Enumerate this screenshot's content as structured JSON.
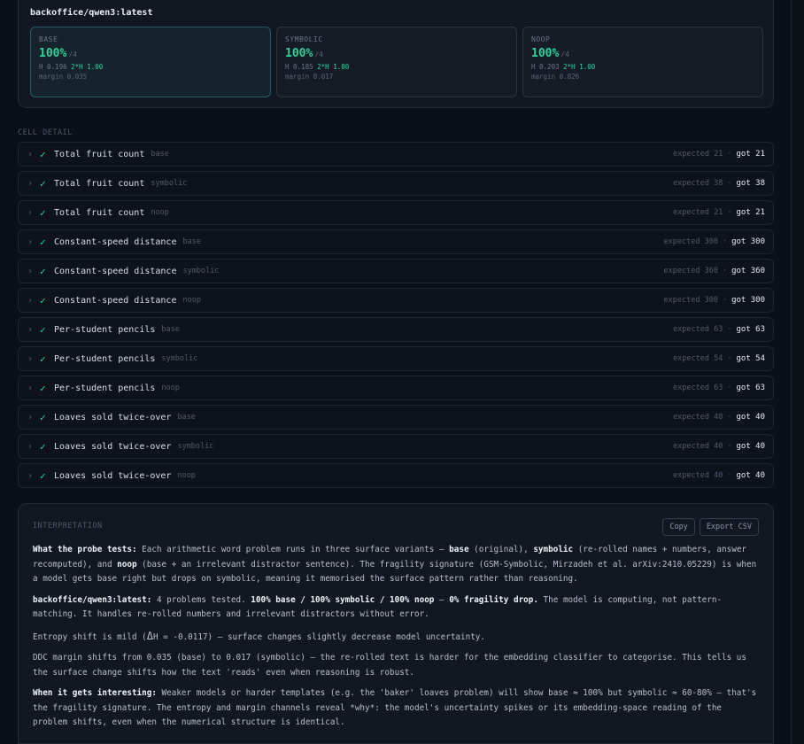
{
  "model": "backoffice/qwen3:latest",
  "variants": [
    {
      "name": "BASE",
      "score": "100%",
      "total": "/4",
      "h_label": "H",
      "h_value": "0.196",
      "h2_label": "2*H",
      "h2_value": "1.00",
      "margin_label": "margin",
      "margin_value": "0.035"
    },
    {
      "name": "SYMBOLIC",
      "score": "100%",
      "total": "/4",
      "h_label": "H",
      "h_value": "0.185",
      "h2_label": "2*H",
      "h2_value": "1.00",
      "margin_label": "margin",
      "margin_value": "0.017"
    },
    {
      "name": "NOOP",
      "score": "100%",
      "total": "/4",
      "h_label": "H",
      "h_value": "0.203",
      "h2_label": "2*H",
      "h2_value": "1.00",
      "margin_label": "margin",
      "margin_value": "0.026"
    }
  ],
  "cell_detail_label": "CELL DETAIL",
  "rows": [
    {
      "chev": "›",
      "check": "✓",
      "title": "Total fruit count",
      "variant": "base",
      "expected": "expected 21",
      "sep": "·",
      "got": "got 21"
    },
    {
      "chev": "›",
      "check": "✓",
      "title": "Total fruit count",
      "variant": "symbolic",
      "expected": "expected 38",
      "sep": "·",
      "got": "got 38"
    },
    {
      "chev": "›",
      "check": "✓",
      "title": "Total fruit count",
      "variant": "noop",
      "expected": "expected 21",
      "sep": "·",
      "got": "got 21"
    },
    {
      "chev": "›",
      "check": "✓",
      "title": "Constant-speed distance",
      "variant": "base",
      "expected": "expected 300",
      "sep": "·",
      "got": "got 300"
    },
    {
      "chev": "›",
      "check": "✓",
      "title": "Constant-speed distance",
      "variant": "symbolic",
      "expected": "expected 360",
      "sep": "·",
      "got": "got 360"
    },
    {
      "chev": "›",
      "check": "✓",
      "title": "Constant-speed distance",
      "variant": "noop",
      "expected": "expected 300",
      "sep": "·",
      "got": "got 300"
    },
    {
      "chev": "›",
      "check": "✓",
      "title": "Per-student pencils",
      "variant": "base",
      "expected": "expected 63",
      "sep": "·",
      "got": "got 63"
    },
    {
      "chev": "›",
      "check": "✓",
      "title": "Per-student pencils",
      "variant": "symbolic",
      "expected": "expected 54",
      "sep": "·",
      "got": "got 54"
    },
    {
      "chev": "›",
      "check": "✓",
      "title": "Per-student pencils",
      "variant": "noop",
      "expected": "expected 63",
      "sep": "·",
      "got": "got 63"
    },
    {
      "chev": "›",
      "check": "✓",
      "title": "Loaves sold twice-over",
      "variant": "base",
      "expected": "expected 40",
      "sep": "·",
      "got": "got 40"
    },
    {
      "chev": "›",
      "check": "✓",
      "title": "Loaves sold twice-over",
      "variant": "symbolic",
      "expected": "expected 40",
      "sep": "·",
      "got": "got 40"
    },
    {
      "chev": "›",
      "check": "✓",
      "title": "Loaves sold twice-over",
      "variant": "noop",
      "expected": "expected 40",
      "sep": "·",
      "got": "got 40"
    }
  ],
  "interpretation": {
    "label": "INTERPRETATION",
    "copy_label": "Copy",
    "export_label": "Export CSV",
    "p1": {
      "lead": "What the probe tests:",
      "t1": " Each arithmetic word problem runs in three surface variants — ",
      "b1": "base",
      "t2": " (original), ",
      "b2": "symbolic",
      "t3": " (re-rolled names + numbers, answer recomputed), and ",
      "b3": "noop",
      "t4": " (base + an irrelevant distractor sentence). The fragility signature (GSM-Symbolic, Mirzadeh et al. arXiv:2410.05229) is when a model gets base right but drops on symbolic, meaning it memorised the surface pattern rather than reasoning."
    },
    "p2": {
      "lead": "backoffice/qwen3:latest:",
      "t1": " 4 problems tested. ",
      "b1": "100% base / 100% symbolic / 100% noop",
      "t2": " — ",
      "b2": "0% fragility drop.",
      "t3": " The model is computing, not pattern-matching. It handles re-rolled numbers and irrelevant distractors without error."
    },
    "p3": {
      "t1": "Entropy shift is mild (",
      "delta": "Δ",
      "t2": "H = -0.0117) — surface changes slightly decrease model uncertainty."
    },
    "p4": "DDC margin shifts from 0.035 (base) to 0.017 (symbolic) — the re-rolled text is harder for the embedding classifier to categorise. This tells us the surface change shifts how the text 'reads' even when reasoning is robust.",
    "p5": {
      "lead": "When it gets interesting:",
      "t1": " Weaker models or harder templates (e.g. the 'baker' loaves problem) will show base ≈ 100% but symbolic ≈ 60-80% — that's the fragility signature. The entropy and margin channels reveal *why*: the model's uncertainty spikes or its embedding-space reading of the problem shifts, even when the numerical structure is identical."
    }
  },
  "colors": {
    "accent": "#2fd39b",
    "background": "#0b0f17",
    "card": "#121821"
  }
}
